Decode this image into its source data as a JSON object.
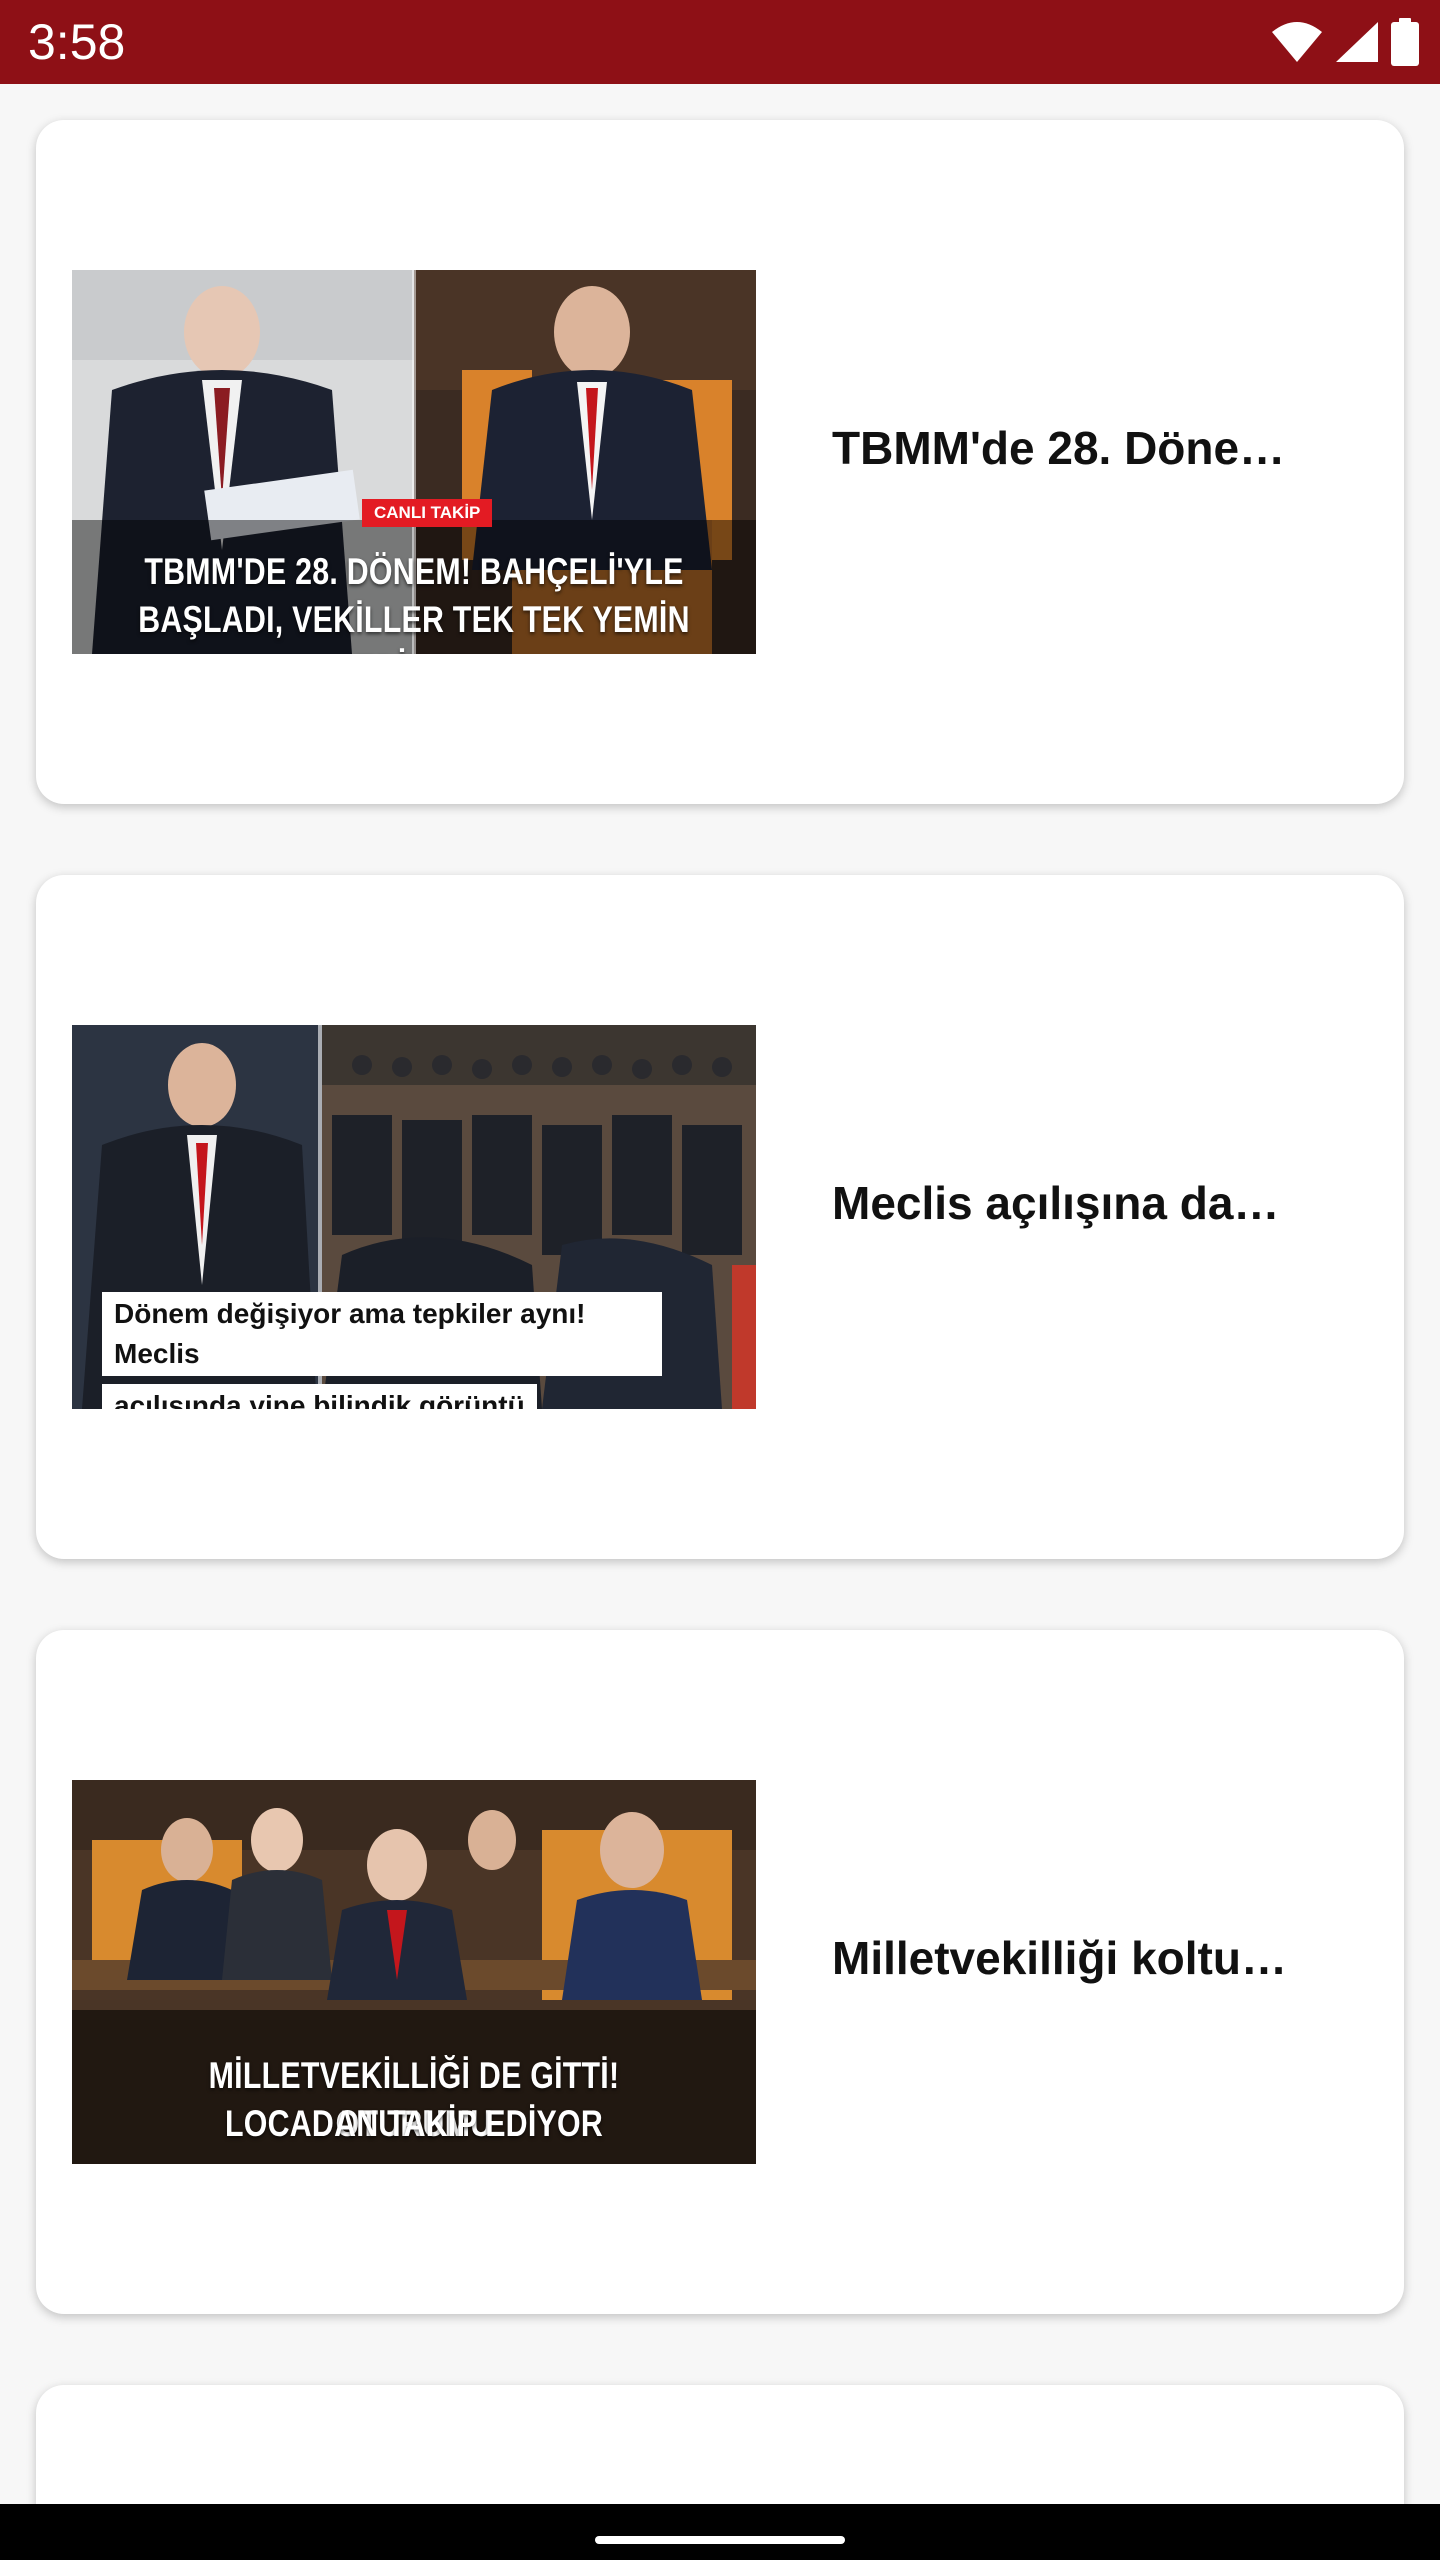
{
  "status_bar": {
    "time": "3:58",
    "icons": [
      "wifi-icon",
      "signal-icon",
      "battery-icon"
    ],
    "background": "#8e1016"
  },
  "feed": {
    "items": [
      {
        "title": "TBMM'de 28. Döne…",
        "thumb_badge": "CANLI TAKİP",
        "thumb_caption_line1": "TBMM'DE 28. DÖNEM! BAHÇELİ'YLE",
        "thumb_caption_line2": "BAŞLADI, VEKİLLER TEK TEK YEMİN EDİYOR"
      },
      {
        "title": "Meclis açılışına da…",
        "thumb_caption_line1": "Dönem değişiyor ama tepkiler aynı! Meclis",
        "thumb_caption_line2": "açılışında yine bilindik görüntü"
      },
      {
        "title": "Milletvekilliği koltu…",
        "thumb_caption_line1": "MİLLETVEKİLLİĞİ DE GİTTİ! OTURUMU",
        "thumb_caption_line2": "LOCADAN TAKİP EDİYOR"
      }
    ]
  },
  "colors": {
    "accent": "#8e1016",
    "badge": "#e31b23",
    "card": "#ffffff"
  }
}
